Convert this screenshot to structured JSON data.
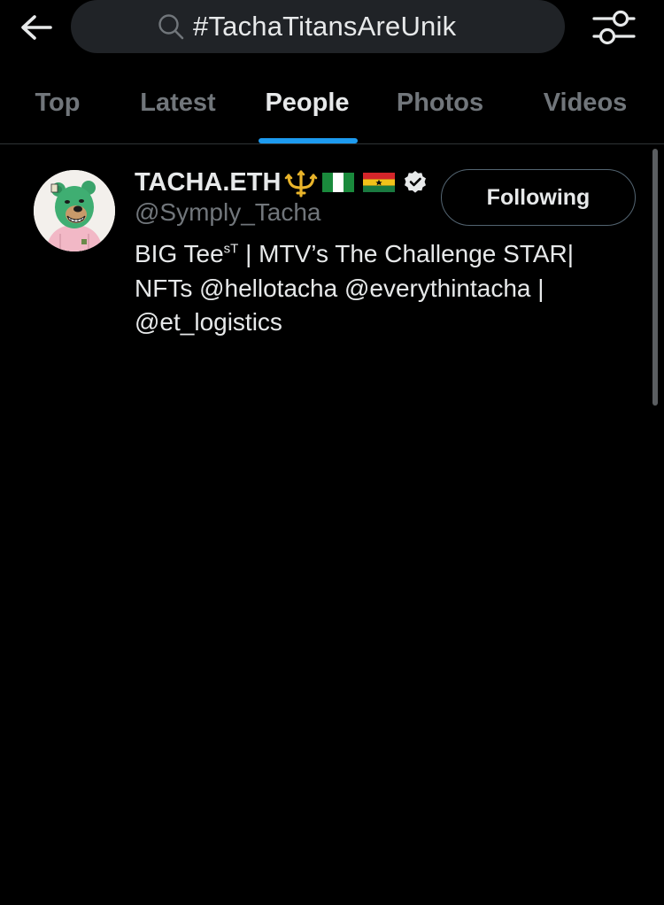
{
  "header": {
    "search_query": "#TachaTitansAreUnik"
  },
  "tabs": [
    {
      "label": "Top",
      "active": false
    },
    {
      "label": "Latest",
      "active": false
    },
    {
      "label": "People",
      "active": true
    },
    {
      "label": "Photos",
      "active": false
    },
    {
      "label": "Videos",
      "active": false
    }
  ],
  "result": {
    "display_name": "TACHA.ETH",
    "name_emojis": [
      "trident-emoji",
      "nigeria-flag",
      "ghana-flag"
    ],
    "verified": true,
    "handle": "@Symply_Tacha",
    "bio_parts": {
      "line1_a": "BIG Tee",
      "line1_sup": "sT",
      "line1_b": " | MTV’s The Challenge STAR|",
      "line2": "NFTs @hellotacha @everythintacha |",
      "line3": "@et_logistics"
    },
    "follow_label": "Following"
  },
  "colors": {
    "background": "#000000",
    "accent": "#1d9bf0",
    "text_primary": "#e7e9ea",
    "text_secondary": "#71767b",
    "search_bg": "#202327"
  }
}
